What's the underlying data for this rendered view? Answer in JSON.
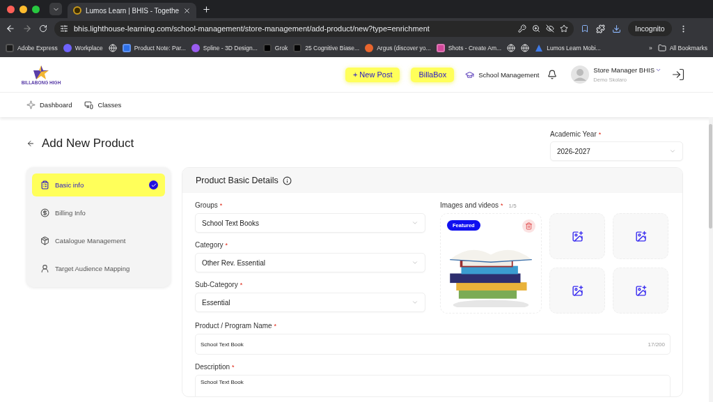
{
  "browser": {
    "tab_title": "Lumos Learn | BHIS - Togethe",
    "url": "bhis.lighthouse-learning.com/school-management/store-management/add-product/new?type=enrichment",
    "profile": "Incognito",
    "bookmarks": [
      {
        "kind": "tile",
        "label": "Adobe Express",
        "color": "#1b1b1b"
      },
      {
        "kind": "ring",
        "label": "Workplace",
        "color": "#6f63ff"
      },
      {
        "kind": "globe"
      },
      {
        "kind": "tile",
        "label": "Product Note: Par...",
        "color": "#2d6fe8"
      },
      {
        "kind": "ring",
        "label": "Spline - 3D Design...",
        "color": "#9a5cf0"
      },
      {
        "kind": "tile",
        "label": "Grok",
        "color": "#000000"
      },
      {
        "kind": "tile",
        "label": "25 Cognitive Biase...",
        "color": "#050505"
      },
      {
        "kind": "ring",
        "label": "Argus (discover yo...",
        "color": "#e8652d"
      },
      {
        "kind": "tile",
        "label": "Shots - Create Am...",
        "color": "#d2479a"
      },
      {
        "kind": "globe"
      },
      {
        "kind": "globe"
      },
      {
        "kind": "triangle",
        "label": "Lumos Learn Mobi...",
        "color": "#3f7ae6"
      }
    ],
    "overflow": "»",
    "all_bookmarks": "All Bookmarks"
  },
  "header": {
    "logo_text": "BILLABONG HIGH",
    "buttons": [
      "+ New Post",
      "BillaBox"
    ],
    "school_management": "School Management",
    "user_name": "Store Manager BHIS",
    "user_org": "Demo Skolaro"
  },
  "nav": [
    {
      "label": "Dashboard",
      "kind": "star"
    },
    {
      "label": "Classes",
      "kind": "classes"
    }
  ],
  "page": {
    "title": "Add New Product",
    "academic_year": {
      "label": "Academic Year",
      "marker": "*",
      "value": "2026-2027"
    }
  },
  "steps": [
    {
      "label": "Basic info",
      "kind": "clipboard",
      "selected": true,
      "completed": true
    },
    {
      "label": "Billing Info",
      "kind": "billing",
      "selected": false,
      "completed": false
    },
    {
      "label": "Catalogue Management",
      "kind": "package",
      "selected": false,
      "completed": false
    },
    {
      "label": "Target Audience Mapping",
      "kind": "user",
      "selected": false,
      "completed": false
    }
  ],
  "form": {
    "title": "Product Basic Details",
    "selects": [
      {
        "label": "Groups",
        "marker": "*",
        "value": "School Text Books"
      },
      {
        "label": "Category",
        "marker": "*",
        "value": "Other Rev. Essential"
      },
      {
        "label": "Sub-Category",
        "marker": "*",
        "value": "Essential"
      }
    ],
    "media": {
      "label": "Images and videos",
      "marker": "*",
      "count": "1/5",
      "featured": "Featured",
      "items": [
        {
          "kind": "picture"
        },
        {
          "kind": "empty"
        },
        {
          "kind": "empty"
        },
        {
          "kind": "empty"
        },
        {
          "kind": "empty"
        }
      ]
    },
    "name": {
      "label": "Product / Program Name",
      "marker": "*",
      "value": "School Text Book",
      "counter": "17/200"
    },
    "description": {
      "label": "Description",
      "marker": "*",
      "value": "School Text Book"
    }
  }
}
